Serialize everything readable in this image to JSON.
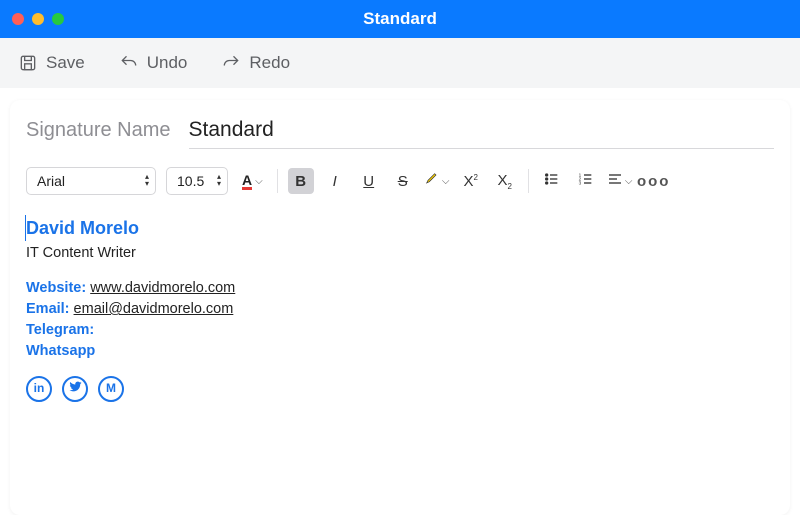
{
  "window": {
    "title": "Standard"
  },
  "filebar": {
    "save": "Save",
    "undo": "Undo",
    "redo": "Redo"
  },
  "signature": {
    "label": "Signature Name",
    "value": "Standard"
  },
  "format": {
    "font": "Arial",
    "size": "10.5"
  },
  "body": {
    "name": "David Morelo",
    "role": "IT Content Writer",
    "website_label": "Website:",
    "website_value": "www.davidmorelo.com",
    "email_label": "Email:",
    "email_value": "email@davidmorelo.com",
    "telegram_label": "Telegram:",
    "whatsapp_label": "Whatsapp"
  },
  "social": {
    "linkedin": "in",
    "twitter": "t",
    "medium": "M"
  },
  "colors": {
    "accent": "#1a73e8",
    "titlebar": "#0a7aff",
    "font_color_underline": "#e53935"
  }
}
